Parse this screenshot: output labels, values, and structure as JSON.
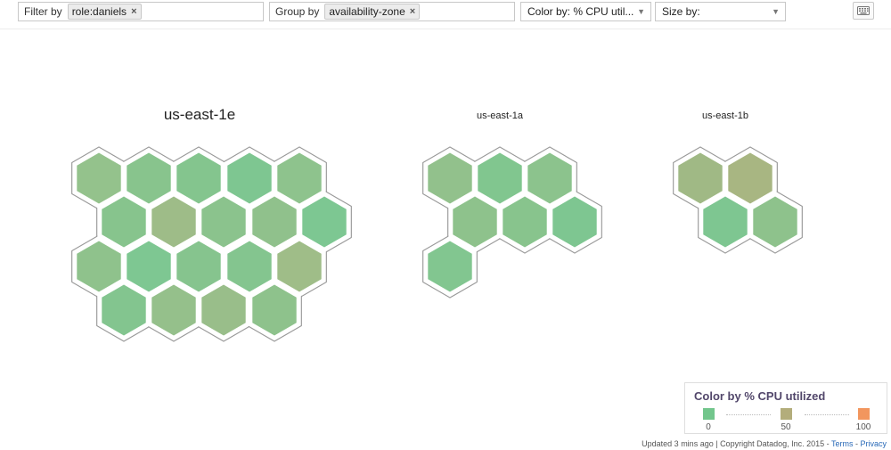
{
  "toolbar": {
    "filter_label": "Filter by",
    "filter_tag": "role:daniels",
    "group_label": "Group by",
    "group_tag": "availability-zone",
    "tag_remove": "×",
    "color_select": "Color by: % CPU util...",
    "size_select": "Size by:"
  },
  "groups": [
    {
      "name": "us-east-1e",
      "host_count": 19,
      "host_colors": [
        "#94c28c",
        "#88c48d",
        "#84c58e",
        "#7ec691",
        "#8ec38d",
        "#87c48d",
        "#9ebc88",
        "#8bc38d",
        "#90c18c",
        "#7dc792",
        "#8fc28c",
        "#7ec792",
        "#86c48e",
        "#84c58f",
        "#9fbd88",
        "#83c58f",
        "#95c08b",
        "#99be8a",
        "#8ec28c"
      ]
    },
    {
      "name": "us-east-1a",
      "host_count": 7,
      "host_colors": [
        "#92c18c",
        "#81c68f",
        "#8cc38d",
        "#8ec28c",
        "#88c48d",
        "#7ec691",
        "#82c690"
      ]
    },
    {
      "name": "us-east-1b",
      "host_count": 4,
      "host_colors": [
        "#a0b985",
        "#a8b682",
        "#7ec691",
        "#8ec28c"
      ]
    }
  ],
  "legend": {
    "title": "Color by % CPU utilized",
    "stops": [
      {
        "value": "0",
        "color": "#72c68c"
      },
      {
        "value": "50",
        "color": "#b3ad7b"
      },
      {
        "value": "100",
        "color": "#f2965e"
      }
    ]
  },
  "footer": {
    "updated": "Updated 3 mins ago",
    "separator": " | ",
    "copyright": "Copyright Datadog, Inc. 2015 - ",
    "terms": "Terms",
    "dash": " - ",
    "privacy": "Privacy"
  }
}
